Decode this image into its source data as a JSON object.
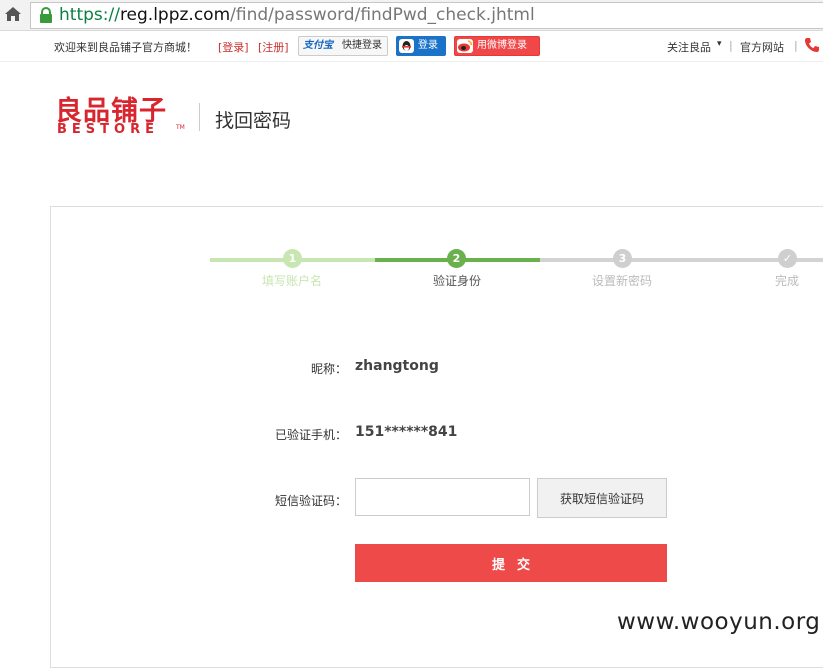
{
  "browser": {
    "url_scheme": "https://",
    "url_host": "reg.lppz.com",
    "url_path": "/find/password/findPwd_check.jhtml",
    "home_icon": "home-icon",
    "lock_icon": "lock-icon"
  },
  "topbar": {
    "welcome": "欢迎来到良品铺子官方商城！",
    "login_link": "[登录]",
    "register_link": "[注册]",
    "alipay_logo": "支付宝",
    "alipay_label": "快捷登录",
    "qq_label": "登录",
    "weibo_label": "用微博登录",
    "follow": "关注良品",
    "follow_caret": "▾",
    "official_site": "官方网站",
    "sep": "|"
  },
  "brand": {
    "name_cn": "良品铺子",
    "name_en": "BESTORE",
    "tm": "TM",
    "page_title": "找回密码",
    "accent": "#d7262e"
  },
  "steps": [
    {
      "num": "1",
      "label": "填写账户名",
      "state": "done"
    },
    {
      "num": "2",
      "label": "验证身份",
      "state": "active"
    },
    {
      "num": "3",
      "label": "设置新密码",
      "state": "todo"
    },
    {
      "num": "✓",
      "label": "完成",
      "state": "todo"
    }
  ],
  "form": {
    "nickname_label": "昵称：",
    "nickname_value": "zhangtong",
    "phone_label": "已验证手机：",
    "phone_value": "151******841",
    "sms_label": "短信验证码：",
    "sms_value": "",
    "sms_button": "获取短信验证码",
    "submit": "提交"
  },
  "watermark": "www.wooyun.org",
  "colors": {
    "step_done": "#c8e6b1",
    "step_active": "#6ab04c",
    "step_todo": "#cfcfcf",
    "submit": "#ef4a4a"
  }
}
